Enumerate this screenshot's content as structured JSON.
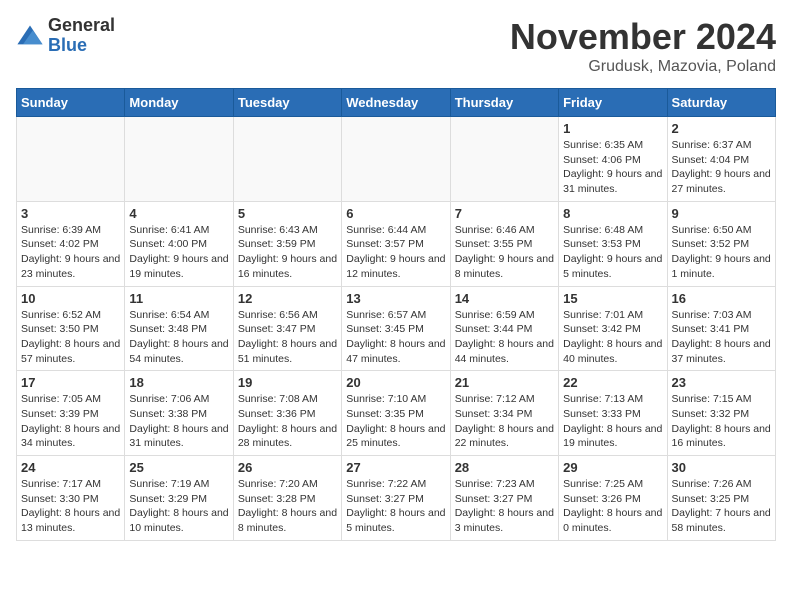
{
  "logo": {
    "general": "General",
    "blue": "Blue"
  },
  "title": "November 2024",
  "location": "Grudusk, Mazovia, Poland",
  "days_of_week": [
    "Sunday",
    "Monday",
    "Tuesday",
    "Wednesday",
    "Thursday",
    "Friday",
    "Saturday"
  ],
  "weeks": [
    [
      {
        "day": "",
        "info": ""
      },
      {
        "day": "",
        "info": ""
      },
      {
        "day": "",
        "info": ""
      },
      {
        "day": "",
        "info": ""
      },
      {
        "day": "",
        "info": ""
      },
      {
        "day": "1",
        "info": "Sunrise: 6:35 AM\nSunset: 4:06 PM\nDaylight: 9 hours and 31 minutes."
      },
      {
        "day": "2",
        "info": "Sunrise: 6:37 AM\nSunset: 4:04 PM\nDaylight: 9 hours and 27 minutes."
      }
    ],
    [
      {
        "day": "3",
        "info": "Sunrise: 6:39 AM\nSunset: 4:02 PM\nDaylight: 9 hours and 23 minutes."
      },
      {
        "day": "4",
        "info": "Sunrise: 6:41 AM\nSunset: 4:00 PM\nDaylight: 9 hours and 19 minutes."
      },
      {
        "day": "5",
        "info": "Sunrise: 6:43 AM\nSunset: 3:59 PM\nDaylight: 9 hours and 16 minutes."
      },
      {
        "day": "6",
        "info": "Sunrise: 6:44 AM\nSunset: 3:57 PM\nDaylight: 9 hours and 12 minutes."
      },
      {
        "day": "7",
        "info": "Sunrise: 6:46 AM\nSunset: 3:55 PM\nDaylight: 9 hours and 8 minutes."
      },
      {
        "day": "8",
        "info": "Sunrise: 6:48 AM\nSunset: 3:53 PM\nDaylight: 9 hours and 5 minutes."
      },
      {
        "day": "9",
        "info": "Sunrise: 6:50 AM\nSunset: 3:52 PM\nDaylight: 9 hours and 1 minute."
      }
    ],
    [
      {
        "day": "10",
        "info": "Sunrise: 6:52 AM\nSunset: 3:50 PM\nDaylight: 8 hours and 57 minutes."
      },
      {
        "day": "11",
        "info": "Sunrise: 6:54 AM\nSunset: 3:48 PM\nDaylight: 8 hours and 54 minutes."
      },
      {
        "day": "12",
        "info": "Sunrise: 6:56 AM\nSunset: 3:47 PM\nDaylight: 8 hours and 51 minutes."
      },
      {
        "day": "13",
        "info": "Sunrise: 6:57 AM\nSunset: 3:45 PM\nDaylight: 8 hours and 47 minutes."
      },
      {
        "day": "14",
        "info": "Sunrise: 6:59 AM\nSunset: 3:44 PM\nDaylight: 8 hours and 44 minutes."
      },
      {
        "day": "15",
        "info": "Sunrise: 7:01 AM\nSunset: 3:42 PM\nDaylight: 8 hours and 40 minutes."
      },
      {
        "day": "16",
        "info": "Sunrise: 7:03 AM\nSunset: 3:41 PM\nDaylight: 8 hours and 37 minutes."
      }
    ],
    [
      {
        "day": "17",
        "info": "Sunrise: 7:05 AM\nSunset: 3:39 PM\nDaylight: 8 hours and 34 minutes."
      },
      {
        "day": "18",
        "info": "Sunrise: 7:06 AM\nSunset: 3:38 PM\nDaylight: 8 hours and 31 minutes."
      },
      {
        "day": "19",
        "info": "Sunrise: 7:08 AM\nSunset: 3:36 PM\nDaylight: 8 hours and 28 minutes."
      },
      {
        "day": "20",
        "info": "Sunrise: 7:10 AM\nSunset: 3:35 PM\nDaylight: 8 hours and 25 minutes."
      },
      {
        "day": "21",
        "info": "Sunrise: 7:12 AM\nSunset: 3:34 PM\nDaylight: 8 hours and 22 minutes."
      },
      {
        "day": "22",
        "info": "Sunrise: 7:13 AM\nSunset: 3:33 PM\nDaylight: 8 hours and 19 minutes."
      },
      {
        "day": "23",
        "info": "Sunrise: 7:15 AM\nSunset: 3:32 PM\nDaylight: 8 hours and 16 minutes."
      }
    ],
    [
      {
        "day": "24",
        "info": "Sunrise: 7:17 AM\nSunset: 3:30 PM\nDaylight: 8 hours and 13 minutes."
      },
      {
        "day": "25",
        "info": "Sunrise: 7:19 AM\nSunset: 3:29 PM\nDaylight: 8 hours and 10 minutes."
      },
      {
        "day": "26",
        "info": "Sunrise: 7:20 AM\nSunset: 3:28 PM\nDaylight: 8 hours and 8 minutes."
      },
      {
        "day": "27",
        "info": "Sunrise: 7:22 AM\nSunset: 3:27 PM\nDaylight: 8 hours and 5 minutes."
      },
      {
        "day": "28",
        "info": "Sunrise: 7:23 AM\nSunset: 3:27 PM\nDaylight: 8 hours and 3 minutes."
      },
      {
        "day": "29",
        "info": "Sunrise: 7:25 AM\nSunset: 3:26 PM\nDaylight: 8 hours and 0 minutes."
      },
      {
        "day": "30",
        "info": "Sunrise: 7:26 AM\nSunset: 3:25 PM\nDaylight: 7 hours and 58 minutes."
      }
    ]
  ]
}
